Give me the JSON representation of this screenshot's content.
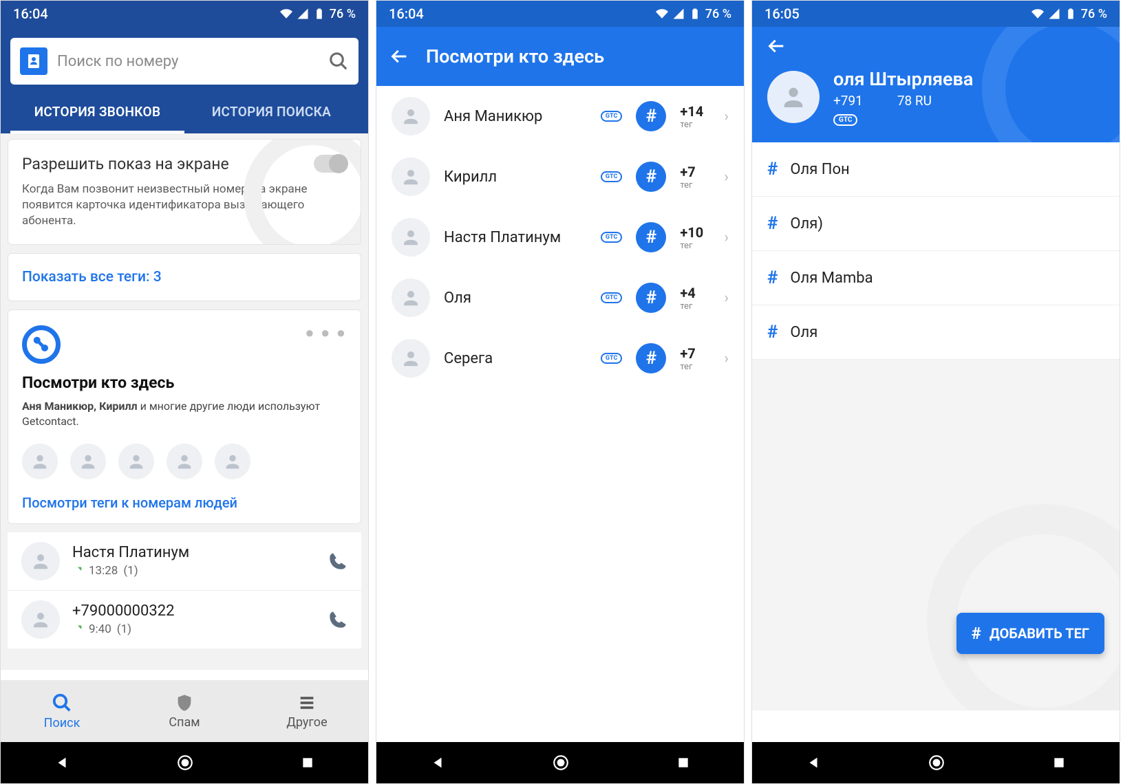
{
  "statusbar": {
    "time_a": "16:04",
    "time_b": "16:04",
    "time_c": "16:05",
    "battery": "76 %"
  },
  "s1": {
    "search_placeholder": "Поиск по номеру",
    "tabs": {
      "calls": "ИСТОРИЯ ЗВОНКОВ",
      "search": "ИСТОРИЯ ПОИСКА"
    },
    "permission": {
      "title": "Разрешить показ на экране",
      "desc": "Когда Вам позвонит неизвестный номер, на экране появится карточка идентификатора вызывающего абонента."
    },
    "all_tags_link": "Показать все теги: 3",
    "promo": {
      "title": "Посмотри кто здесь",
      "names": "Аня Маникюр, Кирилл",
      "rest": " и многие другие люди используют Getcontact.",
      "link": "Посмотри теги к номерам людей"
    },
    "calls": [
      {
        "name": "Настя Платинум",
        "time": "13:28",
        "count": "(1)"
      },
      {
        "name": "+79000000322",
        "time": "9:40",
        "count": "(1)"
      }
    ],
    "nav": {
      "search": "Поиск",
      "spam": "Спам",
      "other": "Другое"
    }
  },
  "s2": {
    "title": "Посмотри кто здесь",
    "tag_label": "тег",
    "people": [
      {
        "name": "Аня Маникюр",
        "tags": "+14"
      },
      {
        "name": "Кирилл",
        "tags": "+7"
      },
      {
        "name": "Настя Платинум",
        "tags": "+10"
      },
      {
        "name": "Оля",
        "tags": "+4"
      },
      {
        "name": "Серега",
        "tags": "+7"
      }
    ]
  },
  "s3": {
    "name": "оля Штырляева",
    "phone_left": "+791",
    "phone_right": "78 RU",
    "gtc": "GTC",
    "tags": [
      "Оля Пон",
      "Оля)",
      "Оля Mamba",
      "Оля"
    ],
    "add_tag": "ДОБАВИТЬ ТЕГ"
  }
}
